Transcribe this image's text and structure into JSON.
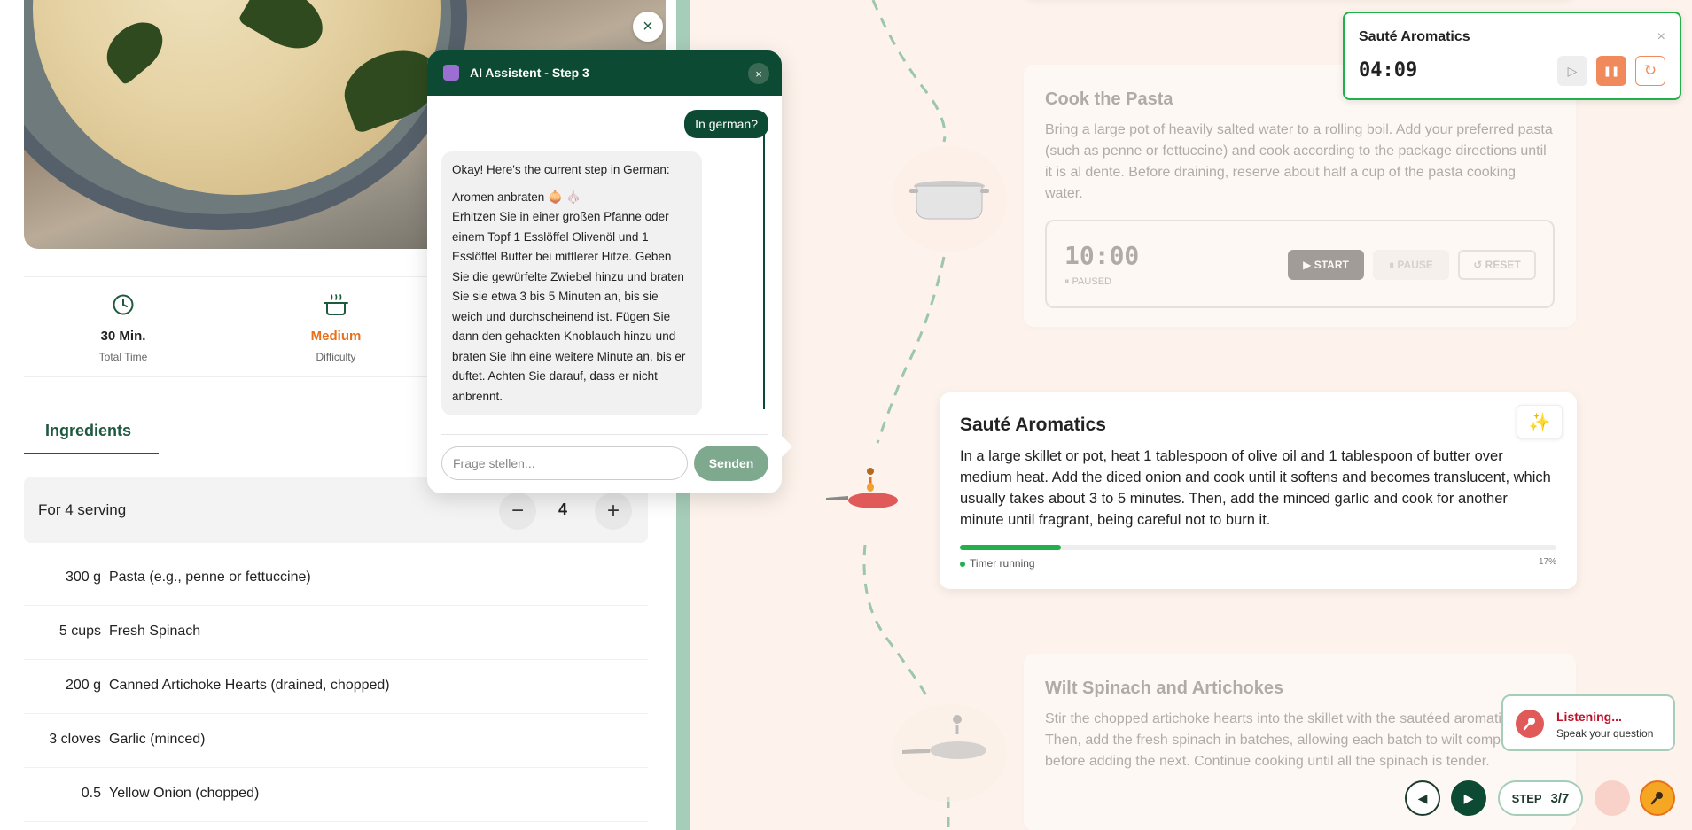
{
  "recipe": {
    "stats": [
      {
        "icon": "clock-icon",
        "value": "30 Min.",
        "label": "Total Time",
        "value_color": "#222222"
      },
      {
        "icon": "pot-icon",
        "value": "Medium",
        "label": "Difficulty",
        "value_color": "#e8701a"
      }
    ],
    "tab_label": "Ingredients",
    "serving": {
      "label": "For 4 serving",
      "count": "4",
      "minus": "−",
      "plus": "+"
    },
    "ingredients": [
      {
        "amount": "300 g",
        "name": "Pasta (e.g., penne or fettuccine)"
      },
      {
        "amount": "5 cups",
        "name": "Fresh Spinach"
      },
      {
        "amount": "200 g",
        "name": "Canned Artichoke Hearts (drained, chopped)"
      },
      {
        "amount": "3 cloves",
        "name": "Garlic (minced)"
      },
      {
        "amount": "0.5",
        "name": "Yellow Onion (chopped)"
      }
    ]
  },
  "chat": {
    "title": "AI Assistent - Step 3",
    "close": "×",
    "user_message": "In german?",
    "bot_intro": "Okay! Here's the current step in German:",
    "bot_heading": "Aromen anbraten 🧅 🧄",
    "bot_body": "Erhitzen Sie in einer großen Pfanne oder einem Topf 1 Esslöffel Olivenöl und 1 Esslöffel Butter bei mittlerer Hitze. Geben Sie die gewürfelte Zwiebel hinzu und braten Sie sie etwa 3 bis 5 Minuten an, bis sie weich und durchscheinend ist. Fügen Sie dann den gehackten Knoblauch hinzu und braten Sie ihn eine weitere Minute an, bis er duftet. Achten Sie darauf, dass er nicht anbrennt.",
    "input_placeholder": "Frage stellen...",
    "send_label": "Senden"
  },
  "steps": {
    "prev": {
      "title": "Cook the Pasta",
      "text": "Bring a large pot of heavily salted water to a rolling boil. Add your preferred pasta (such as penne or fettuccine) and cook according to the package directions until it is al dente. Before draining, reserve about half a cup of the pasta cooking water.",
      "timer": "10:00",
      "timer_status": "⏸ PAUSED",
      "start": "▶ START",
      "pause": "⏸ PAUSE",
      "reset": "↺ RESET"
    },
    "current": {
      "title": "Sauté Aromatics",
      "text": "In a large skillet or pot, heat 1 tablespoon of olive oil and 1 tablespoon of butter over medium heat. Add the diced onion and cook until it softens and becomes translucent, which usually takes about 3 to 5 minutes. Then, add the minced garlic and cook for another minute until fragrant, being careful not to burn it.",
      "status": "Timer running",
      "progress_percent": 17,
      "progress_label": "17%",
      "sparkle": "✨"
    },
    "next": {
      "title": "Wilt Spinach and Artichokes",
      "text": "Stir the chopped artichoke hearts into the skillet with the sautéed aromatics. Then, add the fresh spinach in batches, allowing each batch to wilt completely before adding the next. Continue cooking until all the spinach is tender."
    }
  },
  "floating_timer": {
    "title": "Sauté Aromatics",
    "time": "04:09",
    "close": "×",
    "play": "▷",
    "pause": "❚❚",
    "reset": "↻"
  },
  "listening": {
    "title": "Listening...",
    "subtitle": "Speak your question"
  },
  "nav": {
    "step_label": "STEP",
    "step_value": "3/7",
    "prev": "◀",
    "next": "▶"
  },
  "colors": {
    "brand_green": "#0d4a33",
    "accent_orange": "#e8701a",
    "success_green": "#22b04c",
    "listening_red": "#c0102a"
  }
}
